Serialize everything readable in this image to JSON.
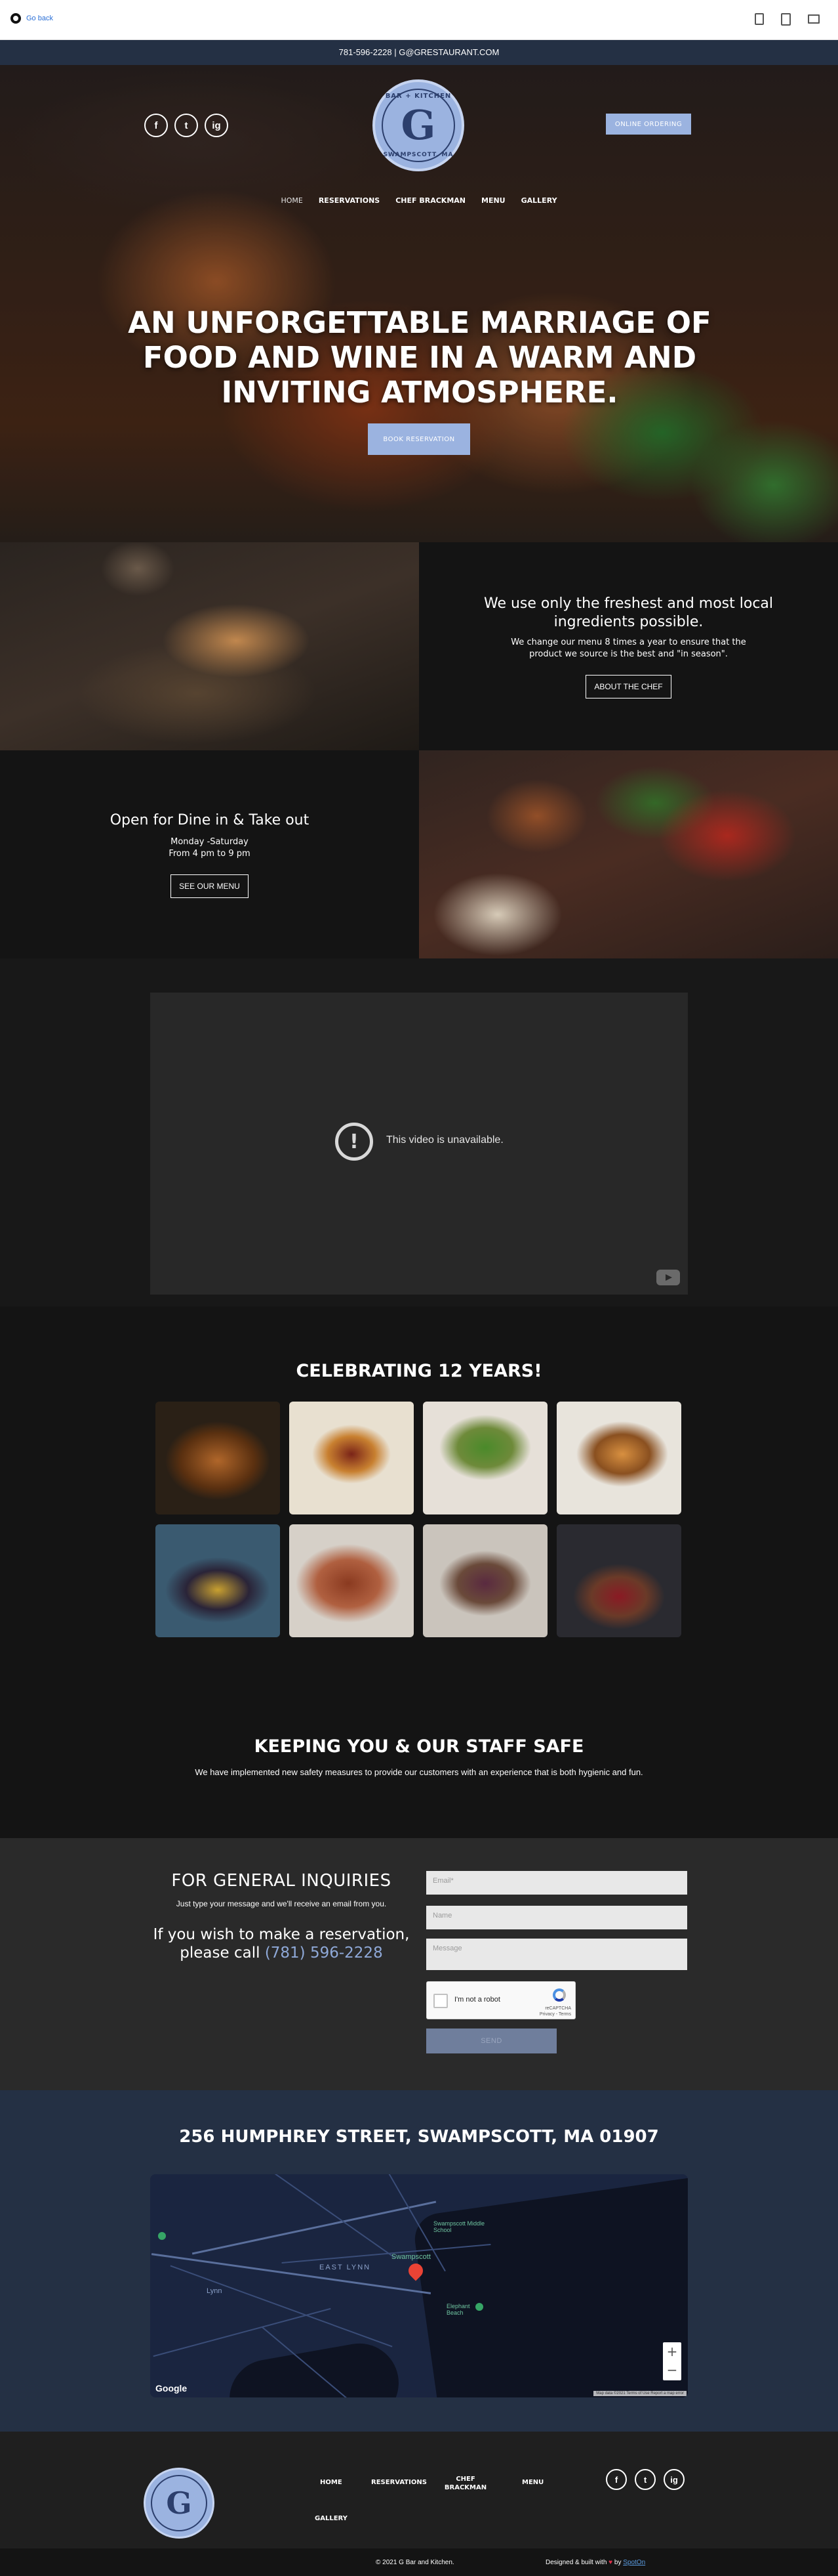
{
  "preview": {
    "go_back": "Go back"
  },
  "contact_strip": {
    "text": "781-596-2228 | G@GRESTAURANT.COM"
  },
  "hero": {
    "social": [
      "f",
      "t",
      "ig"
    ],
    "logo": {
      "top_text": "BAR + KITCHEN",
      "letter": "G",
      "bottom_text": "SWAMPSCOTT, MA"
    },
    "online_ordering": "ONLINE ORDERING",
    "nav": {
      "home": "HOME",
      "reservations": "RESERVATIONS",
      "chef": "CHEF BRACKMAN",
      "menu": "MENU",
      "gallery": "GALLERY"
    },
    "title": "AN UNFORGETTABLE MARRIAGE OF FOOD AND WINE IN A WARM AND INVITING ATMOSPHERE.",
    "book_button": "BOOK RESERVATION"
  },
  "fresh": {
    "heading": "We use only the freshest and most local ingredients possible.",
    "text": "We change our menu 8 times a year to ensure that the product we source is the best and \"in season\".",
    "button": "ABOUT THE CHEF"
  },
  "dine": {
    "heading": "Open for Dine in & Take out",
    "days": "Monday -Saturday",
    "hours": "From 4 pm to 9 pm",
    "button": "SEE OUR MENU"
  },
  "video": {
    "message": "This video is unavailable."
  },
  "gallery": {
    "title": "CELEBRATING 12 YEARS!"
  },
  "safety": {
    "title": "KEEPING YOU & OUR STAFF SAFE",
    "text": "We have implemented new safety measures to provide our customers with an experience that is both hygienic and fun."
  },
  "inquiries": {
    "title": "FOR GENERAL INQUIRIES",
    "sub": "Just type your message and we'll receive an email from you.",
    "call_text": "If you wish to make a reservation, please call",
    "phone": "(781) 596-2228",
    "email_placeholder": "Email*",
    "name_placeholder": "Name",
    "message_placeholder": "Message",
    "captcha_label": "I'm not a robot",
    "captcha_brand": "reCAPTCHA",
    "captcha_links": "Privacy - Terms",
    "send": "SEND"
  },
  "address": {
    "text": "256 HUMPHREY STREET, SWAMPSCOTT, MA 01907",
    "map_labels": {
      "east_lynn": "EAST LYNN",
      "lynn": "Lynn",
      "swampscott": "Swampscott",
      "middle_school": "Swampscott Middle School",
      "elephant": "Elephant Beach"
    },
    "zoom_in": "+",
    "zoom_out": "−",
    "google": "Google",
    "attribution": "Map data ©2021   Terms of Use   Report a map error"
  },
  "footer": {
    "nav": {
      "home": "HOME",
      "reservations": "RESERVATIONS",
      "chef": "CHEF BRACKMAN",
      "menu": "MENU",
      "gallery": "GALLERY"
    },
    "copyright": "© 2021 G Bar and Kitchen.",
    "built_prefix": "Designed & built with",
    "built_by": "by",
    "built_link": "SpotOn"
  }
}
